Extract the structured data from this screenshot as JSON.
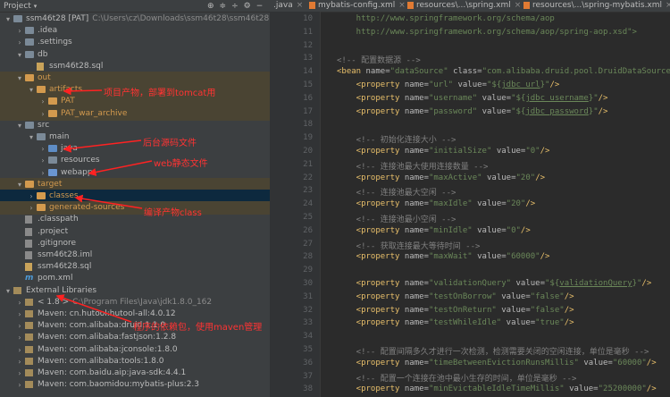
{
  "project_header": {
    "title": "Project",
    "dropdown": "▾",
    "icons": [
      "⊕",
      "≑",
      "÷",
      "⚙",
      "−"
    ]
  },
  "tree": [
    {
      "indent": 0,
      "toggle": "▾",
      "icon": "folder",
      "label": "ssm46t28 [PAT]",
      "path": "C:\\Users\\cz\\Downloads\\ssm46t28\\ssm46t28"
    },
    {
      "indent": 1,
      "toggle": "›",
      "icon": "folder",
      "label": ".idea"
    },
    {
      "indent": 1,
      "toggle": "›",
      "icon": "folder",
      "label": ".settings"
    },
    {
      "indent": 1,
      "toggle": "▾",
      "icon": "folder",
      "label": "db"
    },
    {
      "indent": 2,
      "toggle": "",
      "icon": "sql",
      "label": "ssm46t28.sql"
    },
    {
      "indent": 1,
      "toggle": "▾",
      "icon": "folder-orange",
      "label": "out",
      "hl": true
    },
    {
      "indent": 2,
      "toggle": "▾",
      "icon": "folder-orange",
      "label": "artifacts",
      "hl": true
    },
    {
      "indent": 3,
      "toggle": "›",
      "icon": "folder-orange",
      "label": "PAT",
      "hl": true
    },
    {
      "indent": 3,
      "toggle": "›",
      "icon": "folder-orange",
      "label": "PAT_war_archive",
      "hl": true
    },
    {
      "indent": 1,
      "toggle": "▾",
      "icon": "folder",
      "label": "src"
    },
    {
      "indent": 2,
      "toggle": "▾",
      "icon": "folder",
      "label": "main"
    },
    {
      "indent": 3,
      "toggle": "›",
      "icon": "folder-src",
      "label": "java"
    },
    {
      "indent": 3,
      "toggle": "›",
      "icon": "folder",
      "label": "resources"
    },
    {
      "indent": 3,
      "toggle": "›",
      "icon": "folder-blue",
      "label": "webapp"
    },
    {
      "indent": 1,
      "toggle": "▾",
      "icon": "folder-orange",
      "label": "target",
      "hl": true
    },
    {
      "indent": 2,
      "toggle": "›",
      "icon": "folder-orange",
      "label": "classes",
      "sel": true
    },
    {
      "indent": 2,
      "toggle": "›",
      "icon": "folder-orange",
      "label": "generated-sources",
      "hl": true
    },
    {
      "indent": 1,
      "toggle": "",
      "icon": "misc",
      "label": ".classpath"
    },
    {
      "indent": 1,
      "toggle": "",
      "icon": "misc",
      "label": ".project"
    },
    {
      "indent": 1,
      "toggle": "",
      "icon": "misc",
      "label": ".gitignore"
    },
    {
      "indent": 1,
      "toggle": "",
      "icon": "misc",
      "label": "ssm46t28.iml"
    },
    {
      "indent": 1,
      "toggle": "",
      "icon": "sql",
      "label": "ssm46t28.sql"
    },
    {
      "indent": 1,
      "toggle": "",
      "icon": "maven",
      "label": "pom.xml"
    },
    {
      "indent": 0,
      "toggle": "▾",
      "icon": "lib",
      "label": "External Libraries"
    },
    {
      "indent": 1,
      "toggle": "›",
      "icon": "lib",
      "label": "< 1.8 >",
      "path": "C:\\Program Files\\Java\\jdk1.8.0_162"
    },
    {
      "indent": 1,
      "toggle": "›",
      "icon": "lib",
      "label": "Maven: cn.hutool:hutool-all:4.0.12"
    },
    {
      "indent": 1,
      "toggle": "›",
      "icon": "lib",
      "label": "Maven: com.alibaba:druid:1.1.0"
    },
    {
      "indent": 1,
      "toggle": "›",
      "icon": "lib",
      "label": "Maven: com.alibaba:fastjson:1.2.8"
    },
    {
      "indent": 1,
      "toggle": "›",
      "icon": "lib",
      "label": "Maven: com.alibaba:jconsole:1.8.0"
    },
    {
      "indent": 1,
      "toggle": "›",
      "icon": "lib",
      "label": "Maven: com.alibaba:tools:1.8.0"
    },
    {
      "indent": 1,
      "toggle": "›",
      "icon": "lib",
      "label": "Maven: com.baidu.aip:java-sdk:4.4.1"
    },
    {
      "indent": 1,
      "toggle": "›",
      "icon": "lib",
      "label": "Maven: com.baomidou:mybatis-plus:2.3"
    }
  ],
  "annotations": [
    {
      "text": "项目产物，部署到tomcat用"
    },
    {
      "text": "后台源码文件"
    },
    {
      "text": "web静态文件"
    },
    {
      "text": "编译产物class"
    },
    {
      "text": "程序的依赖包，使用maven管理"
    }
  ],
  "tabs": [
    ".java",
    "mybatis-config.xml",
    "resources\\...\\spring.xml",
    "resources\\...\\spring-mybatis.xml"
  ],
  "code_lines": [
    {
      "n": "10",
      "segs": [
        [
          "url",
          "    http://www.springframework.org/schema/aop"
        ]
      ]
    },
    {
      "n": "11",
      "segs": [
        [
          "url",
          "    http://www.springframework.org/schema/aop/spring-aop.xsd\">"
        ]
      ]
    },
    {
      "n": "12",
      "segs": []
    },
    {
      "n": "13",
      "segs": [
        [
          "cmt",
          "<!-- 配置数据源 -->"
        ]
      ]
    },
    {
      "n": "14",
      "segs": [
        [
          "tag",
          "<bean "
        ],
        [
          "attr",
          "name="
        ],
        [
          "val",
          "\"dataSource\" "
        ],
        [
          "attr",
          "class="
        ],
        [
          "val",
          "\"com.alibaba.druid.pool.DruidDataSource\""
        ]
      ]
    },
    {
      "n": "15",
      "segs": [
        [
          "tag",
          "    <property "
        ],
        [
          "attr",
          "name="
        ],
        [
          "val",
          "\"url\" "
        ],
        [
          "attr",
          "value="
        ],
        [
          "val",
          "\"${"
        ],
        [
          "ph",
          "jdbc_url"
        ],
        [
          "val",
          "}\""
        ],
        [
          "tag",
          "/>"
        ]
      ]
    },
    {
      "n": "16",
      "segs": [
        [
          "tag",
          "    <property "
        ],
        [
          "attr",
          "name="
        ],
        [
          "val",
          "\"username\" "
        ],
        [
          "attr",
          "value="
        ],
        [
          "val",
          "\"${"
        ],
        [
          "ph",
          "jdbc_username"
        ],
        [
          "val",
          "}\""
        ],
        [
          "tag",
          "/>"
        ]
      ]
    },
    {
      "n": "17",
      "segs": [
        [
          "tag",
          "    <property "
        ],
        [
          "attr",
          "name="
        ],
        [
          "val",
          "\"password\" "
        ],
        [
          "attr",
          "value="
        ],
        [
          "val",
          "\"${"
        ],
        [
          "ph",
          "jdbc_password"
        ],
        [
          "val",
          "}\""
        ],
        [
          "tag",
          "/>"
        ]
      ]
    },
    {
      "n": "18",
      "segs": []
    },
    {
      "n": "19",
      "segs": [
        [
          "cmt",
          "    <!-- 初始化连接大小 -->"
        ]
      ]
    },
    {
      "n": "20",
      "segs": [
        [
          "tag",
          "    <property "
        ],
        [
          "attr",
          "name="
        ],
        [
          "val",
          "\"initialSize\" "
        ],
        [
          "attr",
          "value="
        ],
        [
          "val",
          "\"0\""
        ],
        [
          "tag",
          "/>"
        ]
      ]
    },
    {
      "n": "21",
      "segs": [
        [
          "cmt",
          "    <!-- 连接池最大使用连接数量 -->"
        ]
      ]
    },
    {
      "n": "22",
      "segs": [
        [
          "tag",
          "    <property "
        ],
        [
          "attr",
          "name="
        ],
        [
          "val",
          "\"maxActive\" "
        ],
        [
          "attr",
          "value="
        ],
        [
          "val",
          "\"20\""
        ],
        [
          "tag",
          "/>"
        ]
      ]
    },
    {
      "n": "23",
      "segs": [
        [
          "cmt",
          "    <!-- 连接池最大空闲 -->"
        ]
      ]
    },
    {
      "n": "24",
      "segs": [
        [
          "tag",
          "    <property "
        ],
        [
          "attr",
          "name="
        ],
        [
          "val",
          "\"maxIdle\" "
        ],
        [
          "attr",
          "value="
        ],
        [
          "val",
          "\"20\""
        ],
        [
          "tag",
          "/>"
        ]
      ]
    },
    {
      "n": "25",
      "segs": [
        [
          "cmt",
          "    <!-- 连接池最小空闲 -->"
        ]
      ]
    },
    {
      "n": "26",
      "segs": [
        [
          "tag",
          "    <property "
        ],
        [
          "attr",
          "name="
        ],
        [
          "val",
          "\"minIdle\" "
        ],
        [
          "attr",
          "value="
        ],
        [
          "val",
          "\"0\""
        ],
        [
          "tag",
          "/>"
        ]
      ]
    },
    {
      "n": "27",
      "segs": [
        [
          "cmt",
          "    <!-- 获取连接最大等待时间 -->"
        ]
      ]
    },
    {
      "n": "28",
      "segs": [
        [
          "tag",
          "    <property "
        ],
        [
          "attr",
          "name="
        ],
        [
          "val",
          "\"maxWait\" "
        ],
        [
          "attr",
          "value="
        ],
        [
          "val",
          "\"60000\""
        ],
        [
          "tag",
          "/>"
        ]
      ]
    },
    {
      "n": "29",
      "segs": []
    },
    {
      "n": "30",
      "segs": [
        [
          "tag",
          "    <property "
        ],
        [
          "attr",
          "name="
        ],
        [
          "val",
          "\"validationQuery\" "
        ],
        [
          "attr",
          "value="
        ],
        [
          "val",
          "\"${"
        ],
        [
          "ph",
          "validationQuery"
        ],
        [
          "val",
          "}\""
        ],
        [
          "tag",
          "/>"
        ]
      ]
    },
    {
      "n": "31",
      "segs": [
        [
          "tag",
          "    <property "
        ],
        [
          "attr",
          "name="
        ],
        [
          "val",
          "\"testOnBorrow\" "
        ],
        [
          "attr",
          "value="
        ],
        [
          "val",
          "\"false\""
        ],
        [
          "tag",
          "/>"
        ]
      ]
    },
    {
      "n": "32",
      "segs": [
        [
          "tag",
          "    <property "
        ],
        [
          "attr",
          "name="
        ],
        [
          "val",
          "\"testOnReturn\" "
        ],
        [
          "attr",
          "value="
        ],
        [
          "val",
          "\"false\""
        ],
        [
          "tag",
          "/>"
        ]
      ]
    },
    {
      "n": "33",
      "segs": [
        [
          "tag",
          "    <property "
        ],
        [
          "attr",
          "name="
        ],
        [
          "val",
          "\"testWhileIdle\" "
        ],
        [
          "attr",
          "value="
        ],
        [
          "val",
          "\"true\""
        ],
        [
          "tag",
          "/>"
        ]
      ]
    },
    {
      "n": "34",
      "segs": []
    },
    {
      "n": "35",
      "segs": [
        [
          "cmt",
          "    <!-- 配置间隔多久才进行一次检测，检测需要关闭的空闲连接，单位是毫秒 -->"
        ]
      ]
    },
    {
      "n": "36",
      "segs": [
        [
          "tag",
          "    <property "
        ],
        [
          "attr",
          "name="
        ],
        [
          "val",
          "\"timeBetweenEvictionRunsMillis\" "
        ],
        [
          "attr",
          "value="
        ],
        [
          "val",
          "\"60000\""
        ],
        [
          "tag",
          "/>"
        ]
      ]
    },
    {
      "n": "37",
      "segs": [
        [
          "cmt",
          "    <!-- 配置一个连接在池中最小生存的时间，单位是毫秒 -->"
        ]
      ]
    },
    {
      "n": "38",
      "segs": [
        [
          "tag",
          "    <property "
        ],
        [
          "attr",
          "name="
        ],
        [
          "val",
          "\"minEvictableIdleTimeMillis\" "
        ],
        [
          "attr",
          "value="
        ],
        [
          "val",
          "\"25200000\""
        ],
        [
          "tag",
          "/>"
        ]
      ]
    }
  ]
}
